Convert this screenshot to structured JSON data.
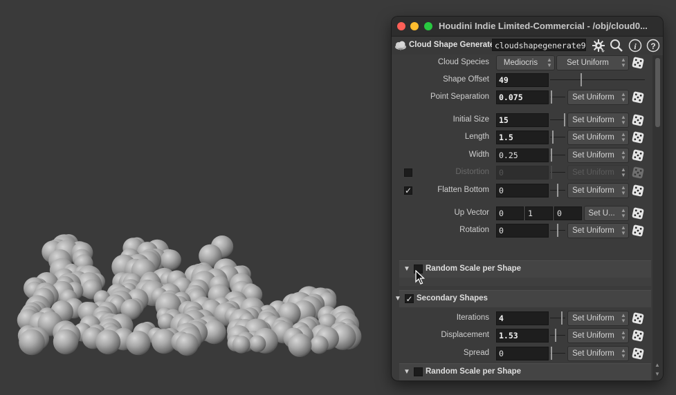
{
  "window": {
    "title": "Houdini Indie Limited-Commercial - /obj/cloud0...",
    "traffic_lights": {
      "close": "#fe5f57",
      "minimize": "#febc2e",
      "zoom": "#28c840"
    }
  },
  "node": {
    "type_label": "Cloud Shape Generate",
    "name": "cloudshapegenerate9",
    "icons": [
      "cloud-icon",
      "gear-icon",
      "search-icon",
      "info-icon",
      "help-icon"
    ]
  },
  "params": {
    "cloud_species": {
      "label": "Cloud Species",
      "value": "Mediocris",
      "button": "Set Uniform"
    },
    "shape_offset": {
      "label": "Shape Offset",
      "value": "49"
    },
    "point_separation": {
      "label": "Point Separation",
      "value": "0.075",
      "button": "Set Uniform"
    },
    "initial_size": {
      "label": "Initial Size",
      "value": "15",
      "button": "Set Uniform"
    },
    "length": {
      "label": "Length",
      "value": "1.5",
      "button": "Set Uniform"
    },
    "width": {
      "label": "Width",
      "value": "0.25",
      "button": "Set Uniform"
    },
    "distortion": {
      "label": "Distortion",
      "value": "0",
      "button": "Set Uniform",
      "enabled": false
    },
    "flatten_bottom": {
      "label": "Flatten Bottom",
      "value": "0",
      "button": "Set Uniform",
      "checked": true
    },
    "up_vector": {
      "label": "Up Vector",
      "x": "0",
      "y": "1",
      "z": "0",
      "button": "Set U..."
    },
    "rotation": {
      "label": "Rotation",
      "value": "0",
      "button": "Set Uniform"
    }
  },
  "folders": {
    "random_scale_1": {
      "label": "Random Scale per Shape",
      "checked": false,
      "expanded": true
    },
    "secondary": {
      "label": "Secondary Shapes",
      "checked": true,
      "expanded": true
    },
    "random_scale_2": {
      "label": "Random Scale per Shape",
      "checked": false,
      "expanded": true
    }
  },
  "secondary_params": {
    "iterations": {
      "label": "Iterations",
      "value": "4",
      "button": "Set Uniform"
    },
    "displacement": {
      "label": "Displacement",
      "value": "1.53",
      "button": "Set Uniform"
    },
    "spread": {
      "label": "Spread",
      "value": "0",
      "button": "Set Uniform"
    }
  },
  "viewport": {
    "content": "cloud-shape-preview"
  }
}
